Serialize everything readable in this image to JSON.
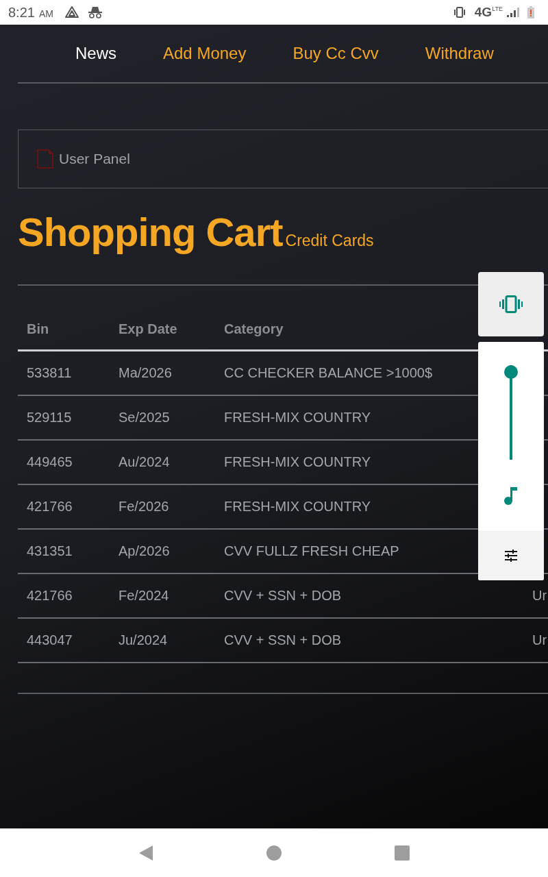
{
  "status_bar": {
    "time": "8:21",
    "ampm": "AM",
    "network": "4G",
    "network_sub": "LTE"
  },
  "nav": [
    {
      "label": "News",
      "selected": true
    },
    {
      "label": "Add Money",
      "selected": false
    },
    {
      "label": "Buy Cc Cvv",
      "selected": false
    },
    {
      "label": "Withdraw",
      "selected": false
    }
  ],
  "panel": {
    "label": "User Panel"
  },
  "heading": {
    "title": "Shopping Cart",
    "subtitle": "Credit Cards"
  },
  "table": {
    "columns": [
      "Bin",
      "Exp Date",
      "Category"
    ],
    "rows": [
      {
        "cells": [
          "533811",
          "Ma/2026",
          "CC CHECKER BALANCE >1000$"
        ]
      },
      {
        "cells": [
          "529115",
          "Se/2025",
          "FRESH-MIX COUNTRY"
        ]
      },
      {
        "cells": [
          "449465",
          "Au/2024",
          "FRESH-MIX COUNTRY"
        ]
      },
      {
        "cells": [
          "421766",
          "Fe/2026",
          "FRESH-MIX COUNTRY"
        ]
      },
      {
        "cells": [
          "431351",
          "Ap/2026",
          "CVV FULLZ FRESH CHEAP"
        ]
      },
      {
        "cells": [
          "421766",
          "Fe/2024",
          "CVV + SSN + DOB"
        ],
        "column_4": "Ur"
      },
      {
        "cells": [
          "443047",
          "Ju/2024",
          "CVV + SSN + DOB"
        ],
        "column_4": "Ur"
      }
    ]
  },
  "volume_panel": {
    "level": 1
  }
}
